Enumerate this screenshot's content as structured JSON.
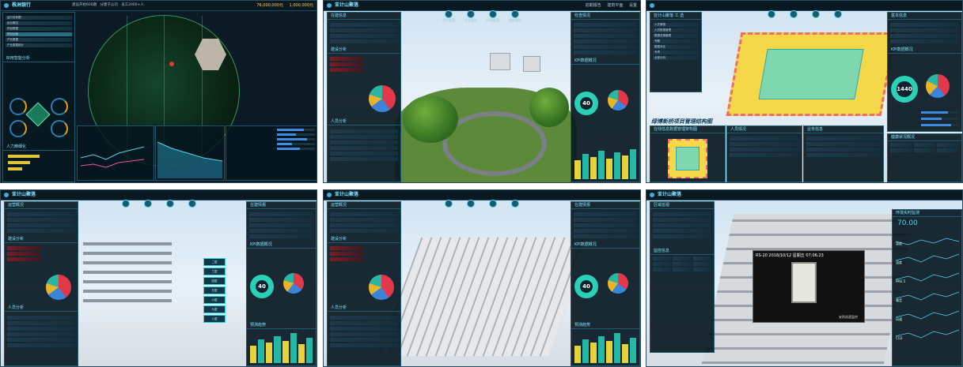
{
  "panels": [
    {
      "id": "p1",
      "title": "株洲银行",
      "top_stats": [
        "建设开始600期",
        "分建子公司",
        "员工2000+人",
        "76,000,000元",
        "1,000,000元"
      ],
      "nav": [
        "运行总体图",
        "综合概览",
        "项目数据",
        "项目运营",
        "产业数据",
        "产业数据统计"
      ],
      "gauges_title": "BI用智能分析",
      "gauge_labels": [
        "产量",
        "用电",
        "能耗",
        "成本"
      ],
      "hr_title": "人力精细化"
    },
    {
      "id": "p2",
      "title": "亚计山聚落",
      "nav_buttons": [
        "生产管理",
        "安全管理",
        "环境管理",
        "能耗管理"
      ],
      "left_sections": [
        "在建信息",
        "建设分析",
        "人员分析"
      ],
      "right_sections": [
        "检查情况",
        "KPI数据概况"
      ],
      "donut_value": "40",
      "top_right": [
        "前期报告",
        "建筑平面",
        "设置"
      ]
    },
    {
      "id": "p3",
      "caption": "绿博新桥项目管理结构图",
      "left_title": "亚计山聚落 工 选",
      "menu": [
        "人员情报",
        "人员数据管理",
        "数据资源管理",
        "专题",
        "数据对比",
        "专项",
        "全部分析"
      ],
      "right_sections": [
        "基本信息",
        "KPI数据概况",
        "健康状况概况"
      ],
      "donut_value": "1440",
      "bottom_sections": [
        "在线信息数据管理架构图",
        "人员情况",
        "业务信息"
      ]
    },
    {
      "id": "p4",
      "title": "亚计山聚落",
      "left_sections": [
        "运营概况",
        "建设分析",
        "人员分析"
      ],
      "right_sections": [
        "在建情报",
        "KPI数据概况",
        "预测趋势"
      ],
      "donut_value": "40",
      "floor_labels": [
        "二层",
        "三层",
        "四层",
        "五层",
        "六层",
        "七层",
        "八层"
      ]
    },
    {
      "id": "p5",
      "title": "亚计山聚落",
      "left_sections": [
        "运营概况",
        "建设分析",
        "人员分析"
      ],
      "right_sections": [
        "在建情报",
        "KPI数据概况",
        "预测趋势"
      ],
      "donut_value": "40"
    },
    {
      "id": "p6",
      "title": "亚计山聚落",
      "left_sections": [
        "区域巡视",
        "监控信息"
      ],
      "right_sections": [
        "环境实时监测"
      ],
      "video_time": "RS-20  2018/10/12  星期五  07:06:23",
      "video_caption": "安防巡逻监控",
      "temperature": "70.00",
      "right_rows": [
        "湿度",
        "温度",
        "PM2.5",
        "噪音",
        "风速",
        "CO2"
      ]
    }
  ],
  "colors": {
    "cyan": "#4fd6f0",
    "bar_yellow": "#e6d23a",
    "bar_teal": "#23b7a6",
    "donut_teal": "#2ad1b7",
    "alert_red": "#c8303c"
  }
}
